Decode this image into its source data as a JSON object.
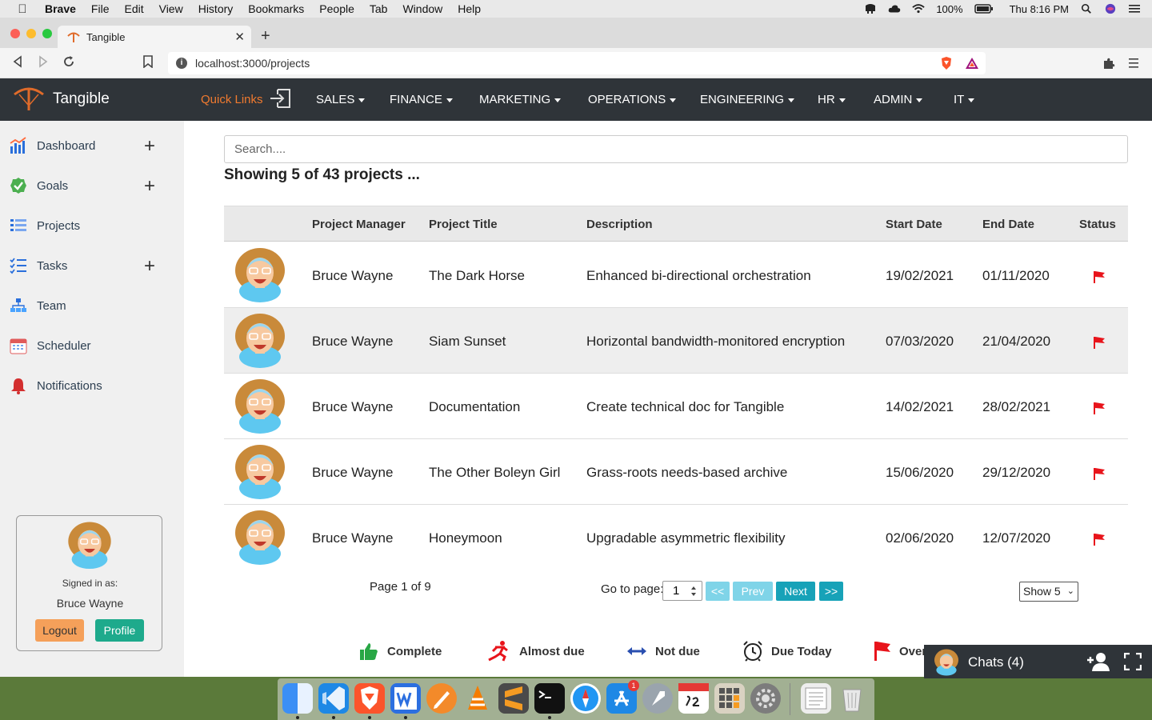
{
  "menubar": {
    "app": "Brave",
    "items": [
      "File",
      "Edit",
      "View",
      "History",
      "Bookmarks",
      "People",
      "Tab",
      "Window",
      "Help"
    ],
    "battery": "100%",
    "clock": "Thu 8:16 PM"
  },
  "browser": {
    "tab_title": "Tangible",
    "url": "localhost:3000/projects"
  },
  "app": {
    "brand": "Tangible",
    "quick_links": "Quick Links",
    "nav": [
      "SALES",
      "FINANCE",
      "MARKETING",
      "OPERATIONS",
      "ENGINEERING",
      "HR",
      "ADMIN",
      "IT"
    ]
  },
  "sidebar": {
    "items": [
      {
        "label": "Dashboard",
        "icon": "chart-icon"
      },
      {
        "label": "Goals",
        "icon": "check-circle-icon"
      },
      {
        "label": "Projects",
        "icon": "list-icon"
      },
      {
        "label": "Tasks",
        "icon": "checklist-icon"
      },
      {
        "label": "Team",
        "icon": "org-chart-icon"
      },
      {
        "label": "Scheduler",
        "icon": "calendar-icon"
      },
      {
        "label": "Notifications",
        "icon": "bell-icon"
      }
    ],
    "signed_in_label": "Signed in as:",
    "user_name": "Bruce Wayne",
    "logout": "Logout",
    "profile": "Profile"
  },
  "main": {
    "search_placeholder": "Search....",
    "showing": "Showing 5 of 43 projects ...",
    "columns": [
      "Project Manager",
      "Project Title",
      "Description",
      "Start Date",
      "End Date",
      "Status"
    ],
    "rows": [
      {
        "manager": "Bruce Wayne",
        "title": "The Dark Horse",
        "description": "Enhanced bi-directional orchestration",
        "start": "19/02/2021",
        "end": "01/11/2020"
      },
      {
        "manager": "Bruce Wayne",
        "title": "Siam Sunset",
        "description": "Horizontal bandwidth-monitored encryption",
        "start": "07/03/2020",
        "end": "21/04/2020"
      },
      {
        "manager": "Bruce Wayne",
        "title": "Documentation",
        "description": "Create technical doc for Tangible",
        "start": "14/02/2021",
        "end": "28/02/2021"
      },
      {
        "manager": "Bruce Wayne",
        "title": "The Other Boleyn Girl",
        "description": "Grass-roots needs-based archive",
        "start": "15/06/2020",
        "end": "29/12/2020"
      },
      {
        "manager": "Bruce Wayne",
        "title": "Honeymoon",
        "description": "Upgradable asymmetric flexibility",
        "start": "02/06/2020",
        "end": "12/07/2020"
      }
    ],
    "page_info": "Page 1 of 9",
    "goto_label": "Go to page:",
    "goto_value": "1",
    "first_btn": "<<",
    "prev_btn": "Prev",
    "next_btn": "Next",
    "last_btn": ">>",
    "show_select": "Show 5",
    "legend": [
      {
        "label": "Complete",
        "icon": "thumbs-up-icon"
      },
      {
        "label": "Almost due",
        "icon": "running-person-icon"
      },
      {
        "label": "Not due",
        "icon": "double-arrow-icon"
      },
      {
        "label": "Due Today",
        "icon": "alarm-clock-icon"
      },
      {
        "label": "Over",
        "icon": "red-flag-icon"
      }
    ]
  },
  "chat": {
    "title": "Chats (4)"
  },
  "colors": {
    "nav_bg": "#2f3439",
    "accent_orange": "#f07a2f",
    "teal": "#1eaa8c",
    "info": "#17a2b8",
    "flag_red": "#e8141b"
  }
}
